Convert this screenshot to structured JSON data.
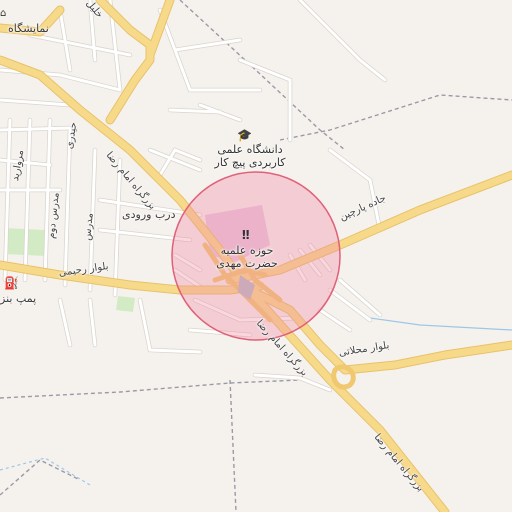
{
  "map": {
    "labels": {
      "top_left_place": "نمایشگاه",
      "university_line1": "دانشگاه علمی",
      "university_line2": "کاربردی پیچ کار",
      "seminary_line1": "حوزه علمیه",
      "seminary_line2": "حضرت مهدی",
      "entrance_gate": "درب ورودی",
      "gas_station": "پمپ بنز",
      "road_parchin": "جاده پارچین",
      "road_imam_reza_n": "بزرگراه امام رضا",
      "road_imam_reza_mid": "بزرگراه امام رضا",
      "road_imam_reza_s": "بزرگراه امام رضا",
      "blvd_rahimi": "بلوار رحیمی",
      "blvd_mahallati": "بلوار محلاتی",
      "street_morvarid": "مروارید",
      "street_heydari": "حیدری",
      "street_modarres_1": "مدرس دوم",
      "street_modarres_2": "مدرس",
      "top_road_partial": "خلیل"
    },
    "icons": {
      "university": "graduation-cap-icon",
      "seminary": "religious-school-icon",
      "gas_station": "fuel-pump-icon",
      "top_left": "place-icon"
    },
    "colors": {
      "background": "#f5f2ee",
      "major_road": "#f7d98a",
      "major_road_casing": "#e8c26a",
      "minor_road": "#ffffff",
      "minor_road_casing": "#d9d4cc",
      "park": "#d2ebc4",
      "poi_area": "#e8c8e0",
      "highlight_circle_fill": "#f08aa0",
      "highlight_circle_stroke": "#e0607a",
      "boundary": "#9a9aa6",
      "water": "#9ec6e8"
    }
  }
}
